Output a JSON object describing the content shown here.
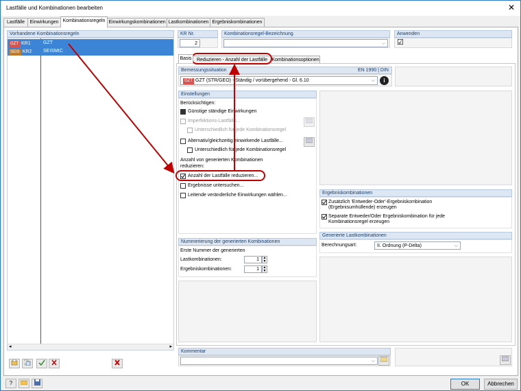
{
  "window": {
    "title": "Lastfälle und Kombinationen bearbeiten",
    "close": "✕"
  },
  "tabs": [
    "Lastfälle",
    "Einwirkungen",
    "Kombinationsregeln",
    "Einwirkungskombinationen",
    "Lastkombinationen",
    "Ergebniskombinationen"
  ],
  "left": {
    "header": "Vorhandene Kombinationsregeln",
    "rows": [
      {
        "tag": "GZT",
        "id": "KR1",
        "name": "GZT"
      },
      {
        "tag": "SEIS",
        "id": "KR2",
        "name": "SEISMIC"
      }
    ]
  },
  "kr": {
    "label": "KR Nr.",
    "value": "2"
  },
  "bezeichnung": {
    "label": "Kombinationsregel-Bezeichnung",
    "value": ""
  },
  "anwenden": {
    "label": "Anwenden",
    "checked": "☑"
  },
  "subtabs": [
    "Basis",
    "Reduzieren - Anzahl der Lastfälle",
    "Kombinationsoptionen"
  ],
  "bemessung": {
    "label": "Bemessungssituation",
    "norm": "EN 1990 | DIN",
    "tag": "GZT",
    "value": "GZT (STR/GEO) - Ständig / vorübergehend - Gl. 6.10"
  },
  "einstellungen": {
    "header": "Einstellungen",
    "beruecksichtigen": "Berücksichtigen:",
    "guenstige": "Günstige ständige Einwirkungen",
    "imperfektion": "Imperfektions-Lastfälle...",
    "unterschiedlich1": "Unterschiedlich für jede Kombinationsregel",
    "alternativ": "Alternativ/gleichzeitig einwirkende Lastfälle...",
    "unterschiedlich2": "Unterschiedlich für jede Kombinationsregel",
    "anzahl_text1": "Anzahl von generierten Kombinationen",
    "anzahl_text2": "reduzieren:",
    "anzahl_reduzieren": "Anzahl der Lastfälle reduzieren...",
    "ergebnisse": "Ergebnisse untersuchen...",
    "leitende": "Leitende veränderliche Einwirkungen wählen..."
  },
  "ergebniskomb": {
    "header": "Ergebniskombinationen",
    "opt1a": "Zusätzlich 'Entweder-Oder'-Ergebniskombination",
    "opt1b": "(Ergebnisumhüllende) erzeugen",
    "opt2a": "Separate Entweder/Oder Ergebniskombination für jede",
    "opt2b": "Kombinationsregel  erzeugen"
  },
  "nummerierung": {
    "header": "Nummerierung der generierten Kombinationen",
    "erste1": "Erste Nummer der generierten",
    "lk_label": "Lastkombinationen:",
    "lk_value": "1",
    "ek_label": "Ergebniskombinationen:",
    "ek_value": "1"
  },
  "generiert": {
    "header": "Generierte Lastkombinationen",
    "label": "Berechnungsart:",
    "value": "II. Ordnung (P-Delta)"
  },
  "kommentar": {
    "label": "Kommentar",
    "value": ""
  },
  "footer": {
    "ok": "OK",
    "cancel": "Abbrechen"
  }
}
